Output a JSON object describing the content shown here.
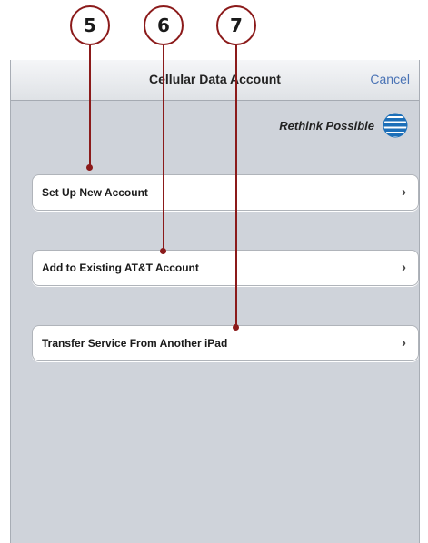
{
  "callouts": [
    "5",
    "6",
    "7"
  ],
  "navbar": {
    "title": "Cellular Data Account",
    "cancel_label": "Cancel"
  },
  "brand": {
    "slogan": "Rethink Possible",
    "logo_icon": "att-globe-icon"
  },
  "rows": [
    {
      "label": "Set Up New Account",
      "icon": "chevron-right-icon"
    },
    {
      "label": "Add to Existing AT&T Account",
      "icon": "chevron-right-icon"
    },
    {
      "label": "Transfer Service From Another iPad",
      "icon": "chevron-right-icon"
    }
  ],
  "colors": {
    "callout_red": "#8b1a1a",
    "background": "#cfd3da",
    "link_blue": "#4a73b5",
    "att_blue": "#1d6fb8"
  }
}
